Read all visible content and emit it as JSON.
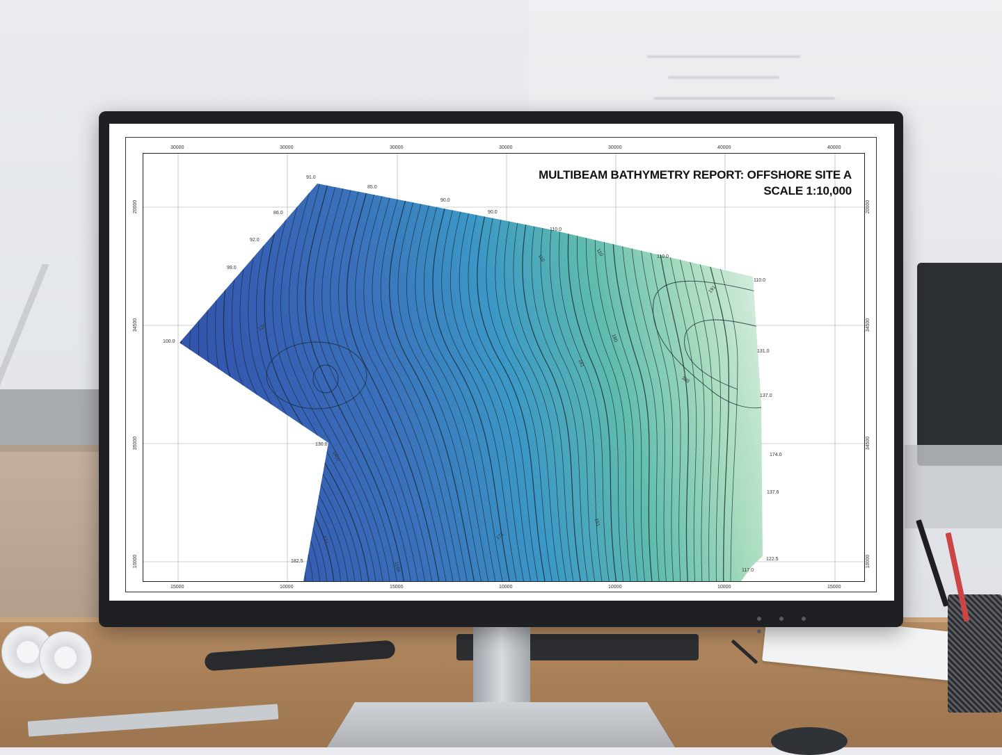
{
  "report": {
    "title": "MULTIBEAM BATHYMETRY REPORT: OFFSHORE SITE A",
    "scale": "SCALE 1:10,000"
  },
  "grid_labels": {
    "top": [
      "30000",
      "30000",
      "30000",
      "30000",
      "30000",
      "40000",
      "40000"
    ],
    "bottom": [
      "15000",
      "10000",
      "15000",
      "10000",
      "10000",
      "10000",
      "15000"
    ],
    "left": [
      "20000",
      "34500",
      "35000",
      "10000"
    ],
    "right": [
      "20000",
      "34500",
      "34500",
      "10000"
    ]
  },
  "depth_labels": [
    "91.0",
    "85.0",
    "90.0",
    "90.0",
    "110.0",
    "86.0",
    "92.0",
    "99.0",
    "110.0",
    "110.0",
    "100.0",
    "131.0",
    "137.0",
    "130.0",
    "174.0",
    "137.6",
    "182.5",
    "122.5",
    "117.0"
  ],
  "contour_labels": [
    "120",
    "110",
    "110",
    "180",
    "151",
    "181",
    "380",
    "1400",
    "174",
    "171",
    "191",
    "1164"
  ],
  "colors": {
    "deep": "#3357b0",
    "mid": "#3a9ac8",
    "shallow": "#7cc9b0",
    "surface": "#e3f1e6",
    "contour": "#1b2a33"
  },
  "monitor": {
    "buttons": [
      "power",
      "menu",
      "input",
      "brightness"
    ]
  }
}
